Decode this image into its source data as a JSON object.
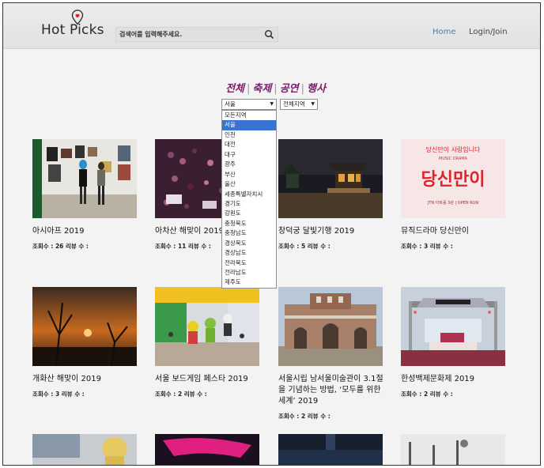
{
  "header": {
    "logo": "Hot Picks",
    "search_placeholder": "검색어를 입력해주세요.",
    "nav_home": "Home",
    "nav_login": "Login/Join"
  },
  "categories": [
    "전체",
    "축제",
    "공연",
    "행사"
  ],
  "filters": {
    "region_selected": "서울",
    "subregion_selected": "전체지역",
    "region_options": [
      "모든지역",
      "서울",
      "인천",
      "대전",
      "대구",
      "광주",
      "부산",
      "울산",
      "세종특별자치시",
      "경기도",
      "강원도",
      "충청북도",
      "충청남도",
      "경상북도",
      "경상남도",
      "전라북도",
      "전라남도",
      "제주도"
    ]
  },
  "meta_labels": {
    "views": "조회수 :",
    "reviews": "리뷰 수 :"
  },
  "cards": [
    {
      "title": "아시아프 2019",
      "views": "26",
      "reviews": ""
    },
    {
      "title": "아차산 해맞이 2019",
      "views": "11",
      "reviews": ""
    },
    {
      "title": "창덕궁 달빛기행 2019",
      "views": "5",
      "reviews": ""
    },
    {
      "title": "뮤직드라마 당신만이",
      "views": "3",
      "reviews": ""
    },
    {
      "title": "개화산 해맞이 2019",
      "views": "3",
      "reviews": ""
    },
    {
      "title": "서울 보드게임 페스타 2019",
      "views": "2",
      "reviews": ""
    },
    {
      "title": "서울시립 남서울미술관이 3.1절을 기념하는 방법, ‘모두를 위한 세계’ 2019",
      "views": "2",
      "reviews": ""
    },
    {
      "title": "한성백제문화제 2019",
      "views": "2",
      "reviews": ""
    }
  ],
  "poster_text": {
    "top": "당신만이 사랑입니다",
    "sub": "MUSIC DRAMA",
    "main": "당신만이",
    "venue": "JTN 아트홀 3관 | OPEN RUN"
  },
  "colors": {
    "category": "#7a1b6c",
    "nav_home": "#4a7ea6",
    "selected_option": "#3b73d3",
    "poster_red": "#d9252e"
  }
}
